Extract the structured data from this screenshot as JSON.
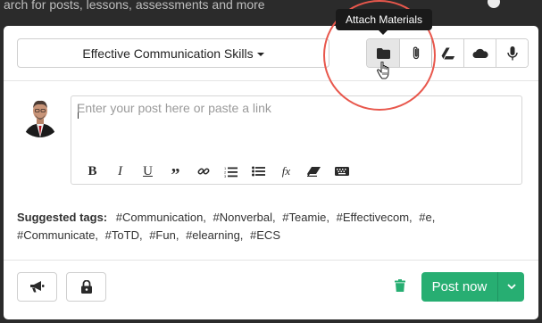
{
  "background": {
    "text": "arch for posts, lessons, assessments and more"
  },
  "tooltip": {
    "text": "Attach Materials"
  },
  "topic_select": {
    "value": "Effective Communication Skills"
  },
  "toolbar": {
    "buttons": [
      {
        "icon": "folder-icon",
        "active": true
      },
      {
        "icon": "paperclip-icon"
      },
      {
        "icon": "google-drive-icon"
      },
      {
        "icon": "onedrive-cloud-icon"
      },
      {
        "icon": "microphone-icon"
      }
    ]
  },
  "editor": {
    "placeholder": "Enter your post here or paste a link",
    "value": "",
    "format_buttons": [
      "B",
      "I",
      "U",
      "”",
      "link-icon",
      "ordered-list-icon",
      "bullet-list-icon",
      "fx",
      "eraser-icon",
      "keyboard-icon"
    ]
  },
  "tags": {
    "label": "Suggested tags:",
    "items": [
      "#Communication,",
      "#Nonverbal,",
      "#Teamie,",
      "#Effectivecom,",
      "#e,",
      "#Communicate,",
      "#ToTD,",
      "#Fun,",
      "#elearning,",
      "#ECS"
    ]
  },
  "footer": {
    "post_label": "Post now"
  },
  "colors": {
    "accent": "#27ae72",
    "highlight": "#e8574c"
  }
}
